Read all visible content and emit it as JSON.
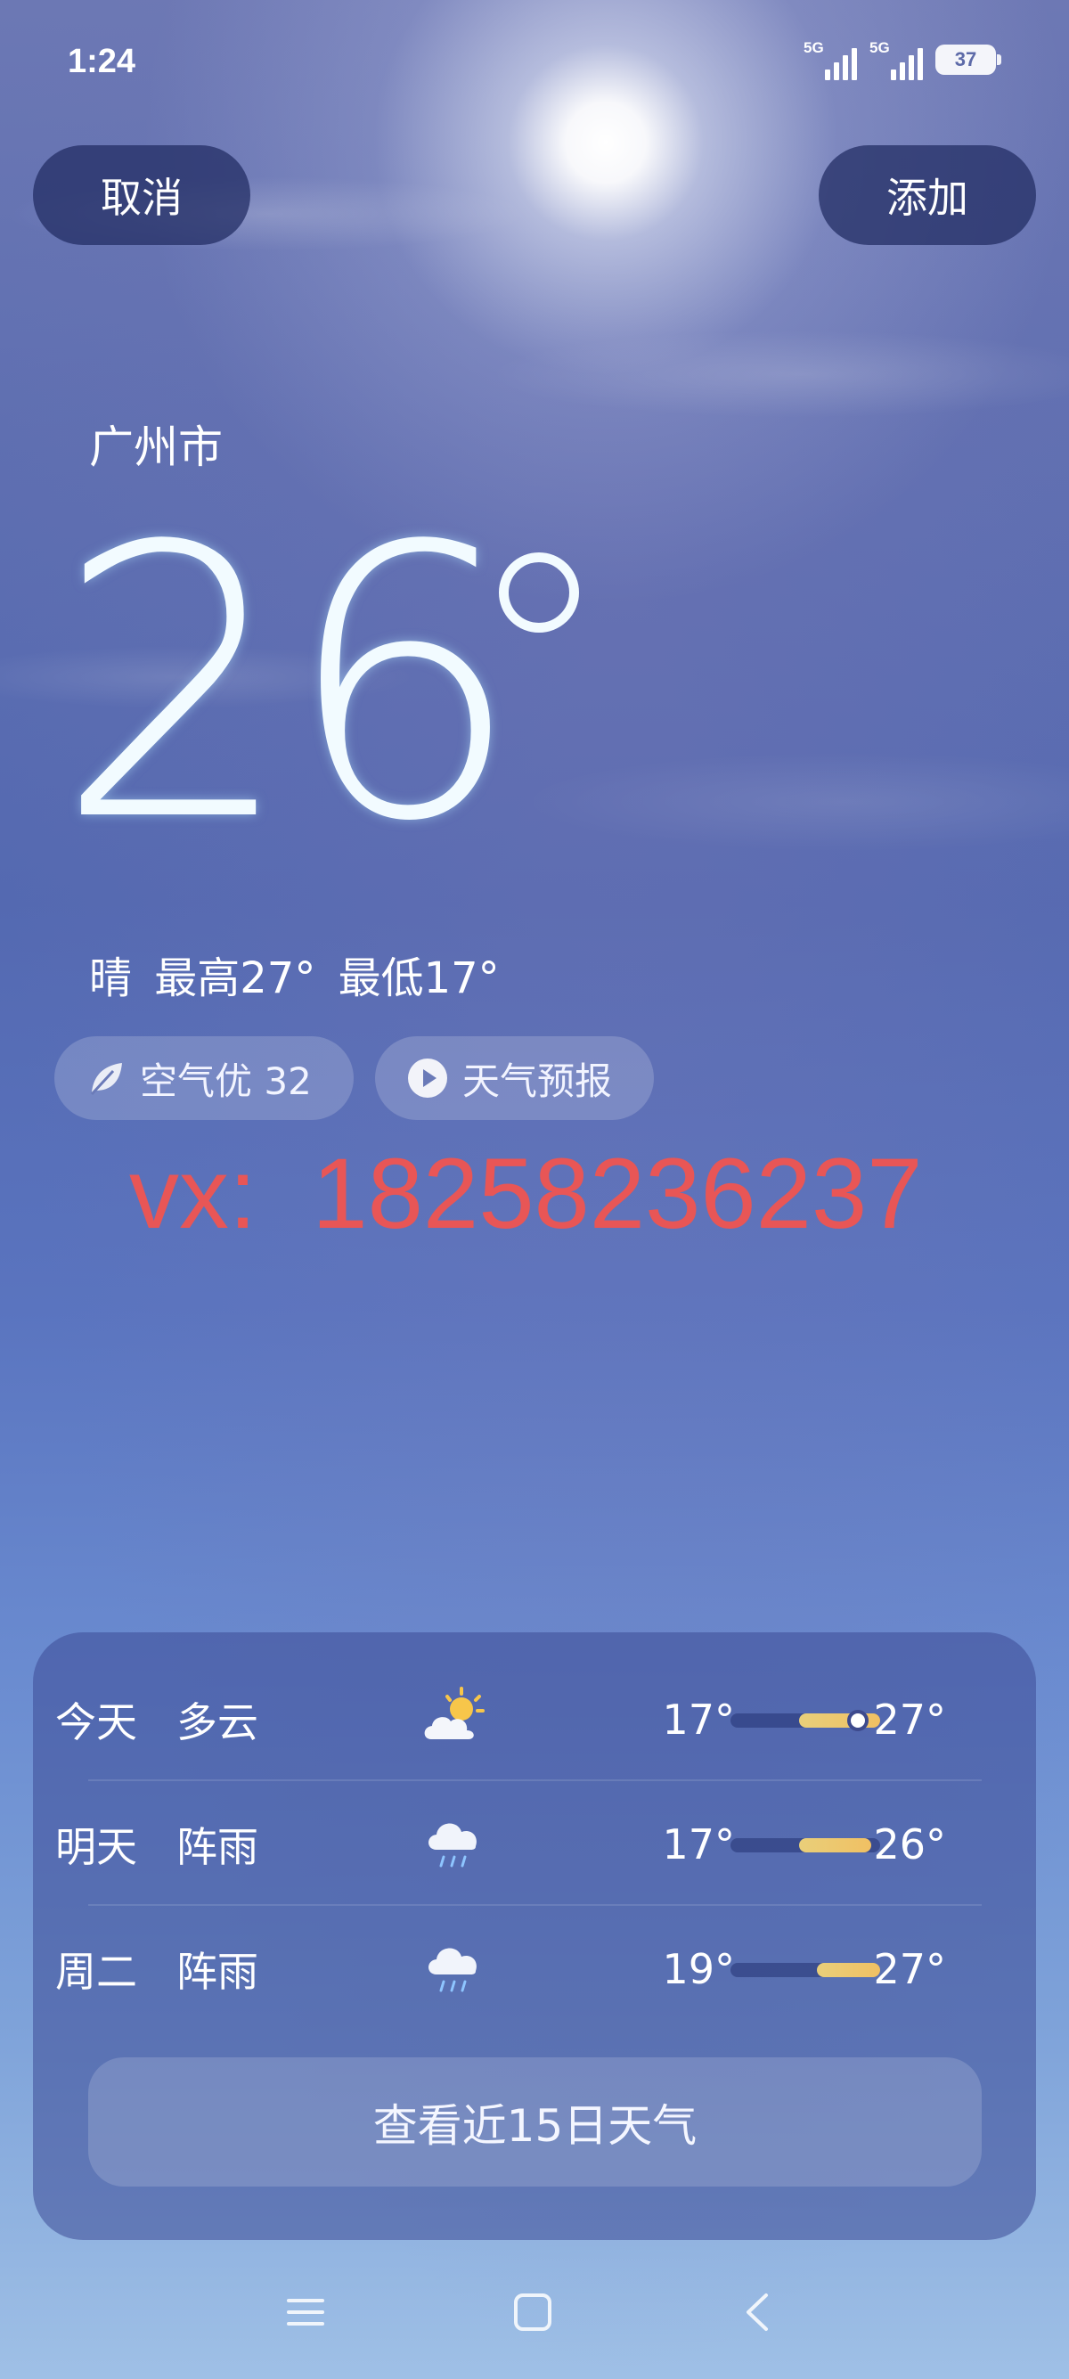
{
  "status_bar": {
    "time": "1:24",
    "signal1_label": "5G",
    "signal2_label": "5G",
    "battery": "37"
  },
  "header": {
    "cancel_label": "取消",
    "add_label": "添加"
  },
  "weather": {
    "city": "广州市",
    "temperature": "26",
    "summary": "晴  最高27°  最低17°",
    "air_label": "空气优 32",
    "forecast_video_label": "天气预报"
  },
  "watermark": "vx:  18258236237",
  "forecast": {
    "days": [
      {
        "day": "今天",
        "condition": "多云",
        "icon": "partly-cloudy-icon",
        "low": "17°",
        "high": "27°",
        "range_start": 0.46,
        "range_end": 1.0,
        "current": 0.85
      },
      {
        "day": "明天",
        "condition": "阵雨",
        "icon": "rain-cloud-icon",
        "low": "17°",
        "high": "26°",
        "range_start": 0.46,
        "range_end": 0.94
      },
      {
        "day": "周二",
        "condition": "阵雨",
        "icon": "rain-cloud-icon",
        "low": "19°",
        "high": "27°",
        "range_start": 0.58,
        "range_end": 1.0
      }
    ],
    "more_label": "查看近15日天气"
  },
  "nav": {
    "icons": [
      "menu-icon",
      "home-icon",
      "back-icon"
    ]
  },
  "colors": {
    "watermark": "#e85656",
    "range_fill": "#f0c063"
  }
}
